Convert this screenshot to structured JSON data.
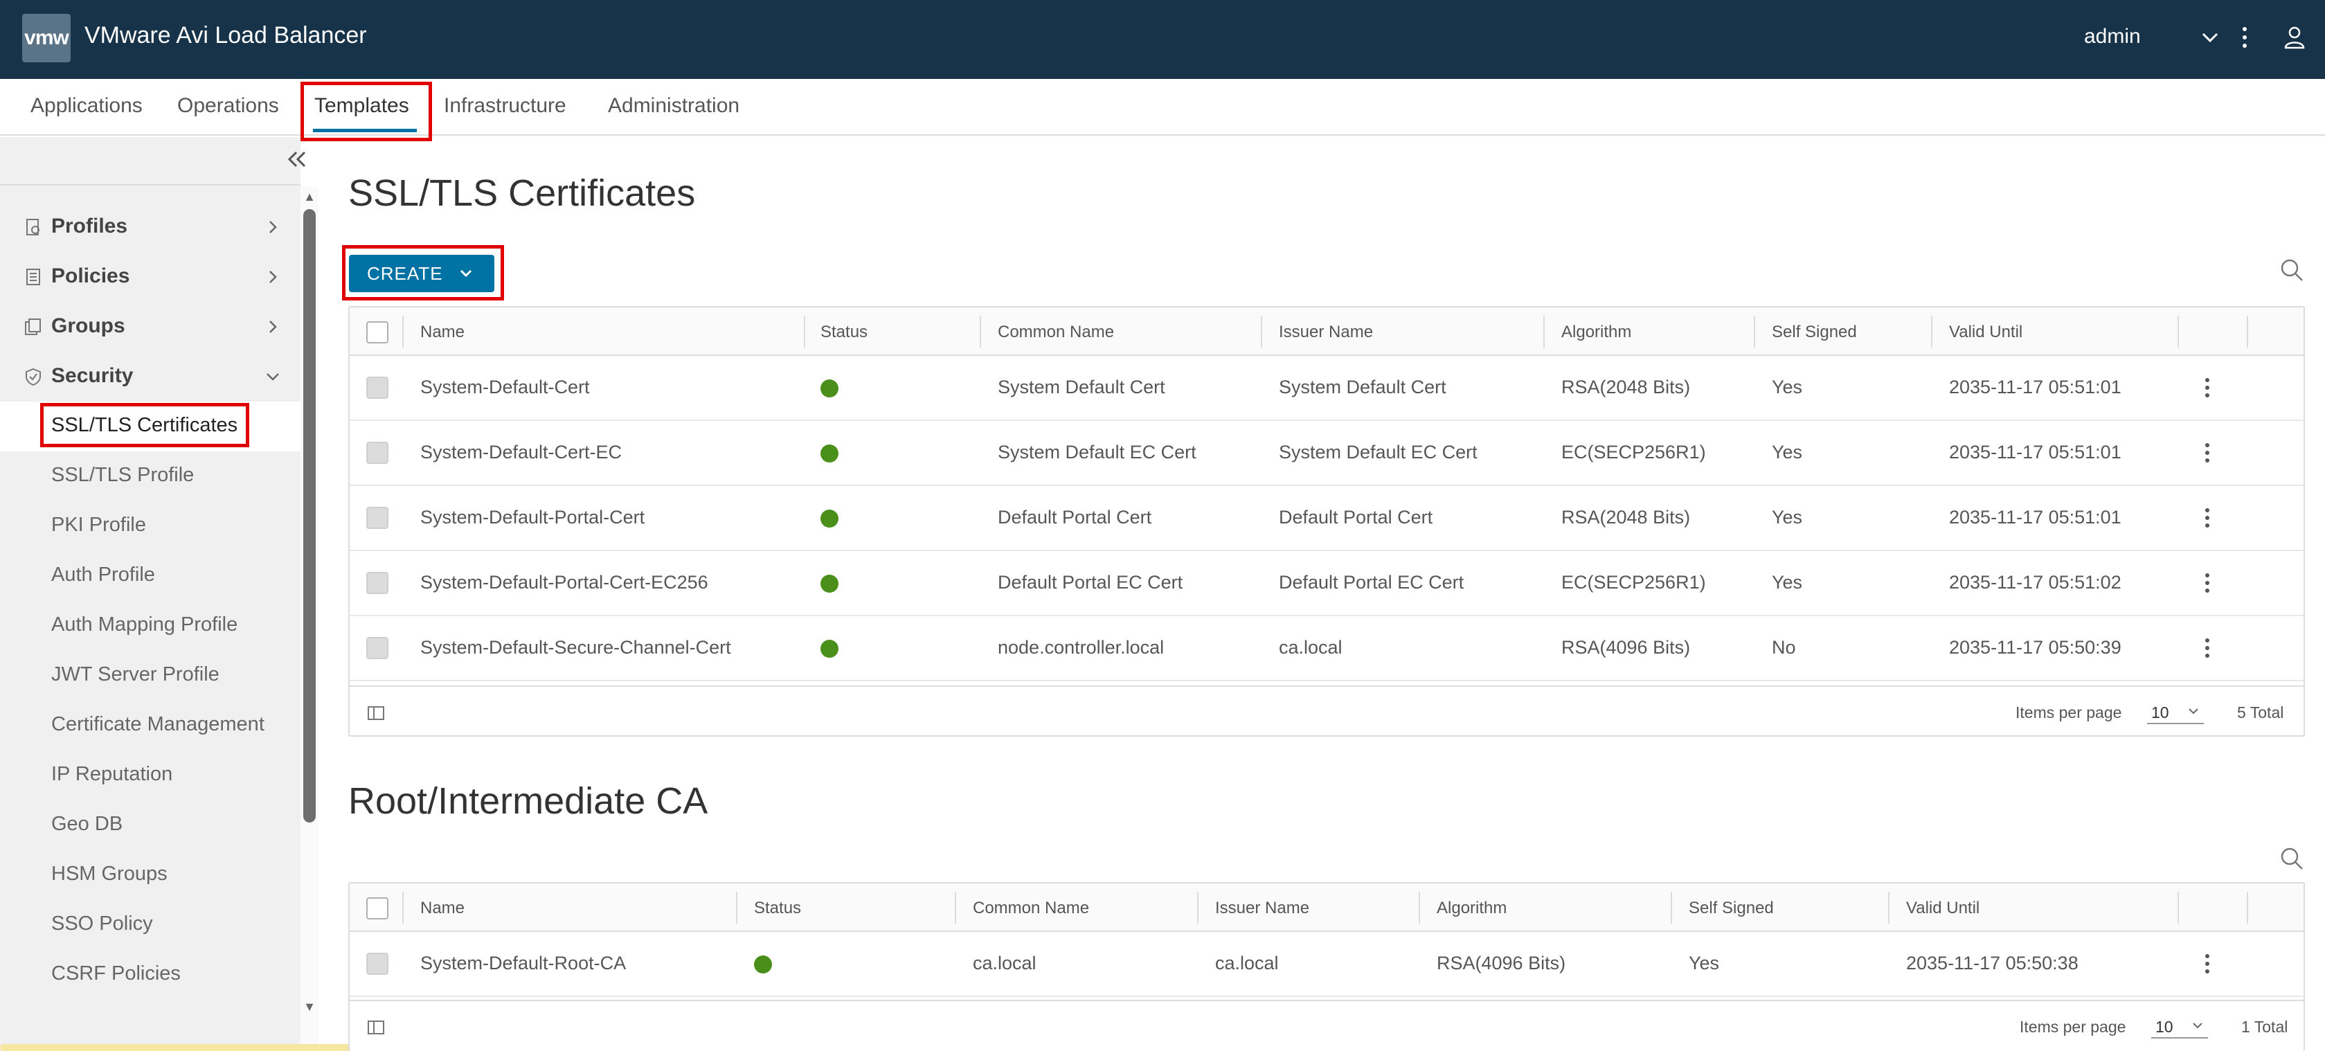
{
  "header": {
    "logo_text": "vmw",
    "app_title": "VMware Avi Load Balancer",
    "user": "admin"
  },
  "nav": {
    "tabs": [
      "Applications",
      "Operations",
      "Templates",
      "Infrastructure",
      "Administration"
    ],
    "active": "Templates"
  },
  "sidebar": {
    "groups": [
      {
        "label": "Profiles",
        "icon": "profile-icon",
        "expanded": false
      },
      {
        "label": "Policies",
        "icon": "policy-icon",
        "expanded": false
      },
      {
        "label": "Groups",
        "icon": "groups-icon",
        "expanded": false
      },
      {
        "label": "Security",
        "icon": "shield-icon",
        "expanded": true
      }
    ],
    "items": [
      "SSL/TLS Certificates",
      "SSL/TLS Profile",
      "PKI Profile",
      "Auth Profile",
      "Auth Mapping Profile",
      "JWT Server Profile",
      "Certificate Management",
      "IP Reputation",
      "Geo DB",
      "HSM Groups",
      "SSO Policy",
      "CSRF Policies"
    ],
    "active_item": "SSL/TLS Certificates"
  },
  "certs": {
    "title": "SSL/TLS Certificates",
    "create_label": "CREATE",
    "columns": [
      "Name",
      "Status",
      "Common Name",
      "Issuer Name",
      "Algorithm",
      "Self Signed",
      "Valid Until"
    ],
    "rows": [
      {
        "name": "System-Default-Cert",
        "status": "ok",
        "common_name": "System Default Cert",
        "issuer": "System Default Cert",
        "algorithm": "RSA(2048 Bits)",
        "self_signed": "Yes",
        "valid_until": "2035-11-17 05:51:01"
      },
      {
        "name": "System-Default-Cert-EC",
        "status": "ok",
        "common_name": "System Default EC Cert",
        "issuer": "System Default EC Cert",
        "algorithm": "EC(SECP256R1)",
        "self_signed": "Yes",
        "valid_until": "2035-11-17 05:51:01"
      },
      {
        "name": "System-Default-Portal-Cert",
        "status": "ok",
        "common_name": "Default Portal Cert",
        "issuer": "Default Portal Cert",
        "algorithm": "RSA(2048 Bits)",
        "self_signed": "Yes",
        "valid_until": "2035-11-17 05:51:01"
      },
      {
        "name": "System-Default-Portal-Cert-EC256",
        "status": "ok",
        "common_name": "Default Portal EC Cert",
        "issuer": "Default Portal EC Cert",
        "algorithm": "EC(SECP256R1)",
        "self_signed": "Yes",
        "valid_until": "2035-11-17 05:51:02"
      },
      {
        "name": "System-Default-Secure-Channel-Cert",
        "status": "ok",
        "common_name": "node.controller.local",
        "issuer": "ca.local",
        "algorithm": "RSA(4096 Bits)",
        "self_signed": "No",
        "valid_until": "2035-11-17 05:50:39"
      }
    ],
    "items_per_page_label": "Items per page",
    "items_per_page": "10",
    "total": "5 Total"
  },
  "ca": {
    "title": "Root/Intermediate CA",
    "columns": [
      "Name",
      "Status",
      "Common Name",
      "Issuer Name",
      "Algorithm",
      "Self Signed",
      "Valid Until"
    ],
    "rows": [
      {
        "name": "System-Default-Root-CA",
        "status": "ok",
        "common_name": "ca.local",
        "issuer": "ca.local",
        "algorithm": "RSA(4096 Bits)",
        "self_signed": "Yes",
        "valid_until": "2035-11-17 05:50:38"
      }
    ],
    "items_per_page_label": "Items per page",
    "items_per_page": "10",
    "total": "1 Total"
  },
  "colors": {
    "header_bg": "#17334a",
    "accent": "#0072a3",
    "status_ok": "#4a8f1a",
    "highlight": "#e00000"
  }
}
